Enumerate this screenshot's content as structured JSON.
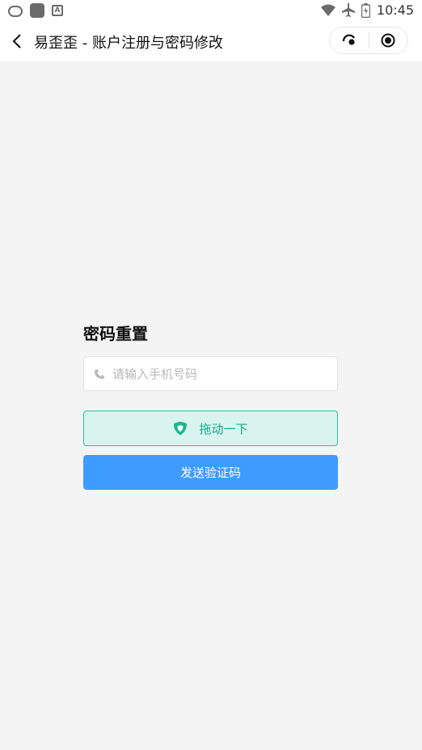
{
  "status_bar": {
    "time": "10:45",
    "left_icons": [
      "loop-app-icon",
      "app-square-icon",
      "font-app-icon"
    ],
    "right_icons": [
      "wifi-icon",
      "airplane-icon",
      "battery-charging-icon"
    ]
  },
  "nav": {
    "title": "易歪歪 - 账户注册与密码修改",
    "back_icon": "chevron-left-icon",
    "capsule_icons": [
      "more-dots-icon",
      "close-target-icon"
    ]
  },
  "form": {
    "heading": "密码重置",
    "phone": {
      "placeholder": "请输入手机号码",
      "value": "",
      "icon": "phone-icon"
    },
    "slider": {
      "label": "拖动一下",
      "icon": "shield-icon"
    },
    "send_button": "发送验证码"
  },
  "colors": {
    "page_background": "#f4f4f4",
    "accent_blue": "#3e9bff",
    "slider_border": "#2fbea0",
    "slider_background": "#d9f4ee",
    "slider_text": "#18a98a"
  }
}
